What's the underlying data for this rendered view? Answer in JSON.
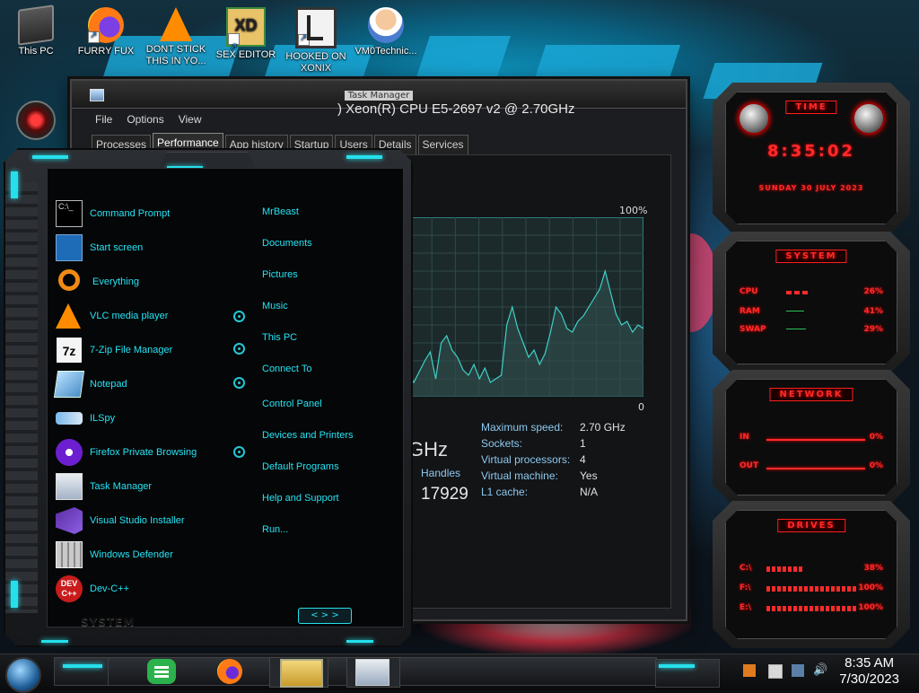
{
  "desktop": {
    "icons": [
      {
        "label": "This PC",
        "icon": "this-pc-icon"
      },
      {
        "label": "FURRY FUX",
        "icon": "firefox-icon"
      },
      {
        "label": "DONT STICK THIS IN YO...",
        "icon": "vlc-icon"
      },
      {
        "label": "SEX EDITOR",
        "icon": "hxd-icon"
      },
      {
        "label": "HOOKED ON XONIX",
        "icon": "xonix-icon"
      },
      {
        "label": "VM0Technic...",
        "icon": "doctor-icon"
      }
    ]
  },
  "task_manager": {
    "title": "Task Manager",
    "menu": [
      "File",
      "Options",
      "View"
    ],
    "tabs": [
      "Processes",
      "Performance",
      "App history",
      "Startup",
      "Users",
      "Details",
      "Services"
    ],
    "active_tab": "Performance",
    "cpu_name": ") Xeon(R) CPU E5-2697 v2 @ 2.70GHz",
    "graph_max_label": "100%",
    "graph_min_label": "0",
    "graph_points_pct": [
      12,
      8,
      14,
      20,
      25,
      10,
      30,
      34,
      26,
      22,
      15,
      12,
      18,
      10,
      16,
      8,
      10,
      12,
      40,
      50,
      38,
      30,
      22,
      26,
      18,
      24,
      36,
      50,
      46,
      38,
      36,
      42,
      45,
      50,
      55,
      60,
      70,
      58,
      46,
      40,
      42,
      36,
      40,
      38
    ],
    "speed_fragment": "GHz",
    "handles_label": "Handles",
    "handles_value": "17929",
    "specs": [
      {
        "key": "Maximum speed:",
        "value": "2.70 GHz"
      },
      {
        "key": "Sockets:",
        "value": "1"
      },
      {
        "key": "Virtual processors:",
        "value": "4"
      },
      {
        "key": "Virtual machine:",
        "value": "Yes"
      },
      {
        "key": "L1 cache:",
        "value": "N/A"
      }
    ]
  },
  "start_menu": {
    "programs": [
      {
        "label": "Command Prompt",
        "icon": "command-prompt-icon"
      },
      {
        "label": "Start screen",
        "icon": "start-screen-icon"
      },
      {
        "label": "Everything",
        "icon": "everything-search-icon"
      },
      {
        "label": "VLC media player",
        "icon": "vlc-icon"
      },
      {
        "label": "7-Zip File Manager",
        "icon": "7zip-icon"
      },
      {
        "label": "Notepad",
        "icon": "notepad-icon"
      },
      {
        "label": "ILSpy",
        "icon": "ilspy-icon"
      },
      {
        "label": "Firefox Private Browsing",
        "icon": "firefox-private-icon"
      },
      {
        "label": "Task Manager",
        "icon": "task-manager-icon"
      },
      {
        "label": "Visual Studio Installer",
        "icon": "visual-studio-icon"
      },
      {
        "label": "Windows Defender",
        "icon": "windows-defender-icon"
      },
      {
        "label": "Dev-C++",
        "icon": "devcpp-icon"
      }
    ],
    "places": [
      "MrBeast",
      "Documents",
      "Pictures",
      "Music",
      "This PC",
      "Connect To",
      "Control Panel",
      "Devices and Printers",
      "Default Programs",
      "Help and Support",
      "Run..."
    ],
    "footer_label": "SYSTEM",
    "nav_arrows": "< > >"
  },
  "gadgets": {
    "time": {
      "title": "TIME",
      "clock": "8:35:02",
      "date": "SUNDAY 30 JULY 2023"
    },
    "system": {
      "title": "SYSTEM",
      "rows": [
        {
          "label": "CPU",
          "value": "26%"
        },
        {
          "label": "RAM",
          "value": "41%"
        },
        {
          "label": "SWAP",
          "value": "29%"
        }
      ]
    },
    "network": {
      "title": "NETWORK",
      "rows": [
        {
          "label": "IN",
          "value": "0%"
        },
        {
          "label": "OUT",
          "value": "0%"
        }
      ]
    },
    "drives": {
      "title": "DRIVES",
      "rows": [
        {
          "label": "C:\\",
          "value": "38%"
        },
        {
          "label": "F:\\",
          "value": "100%"
        },
        {
          "label": "E:\\",
          "value": "100%"
        }
      ]
    }
  },
  "taskbar": {
    "time": "8:35 AM",
    "date": "7/30/2023"
  },
  "colors": {
    "accent_cyan": "#25e0ec",
    "gadget_red": "#ff2a2a",
    "graph_line": "#3fd1c8"
  }
}
